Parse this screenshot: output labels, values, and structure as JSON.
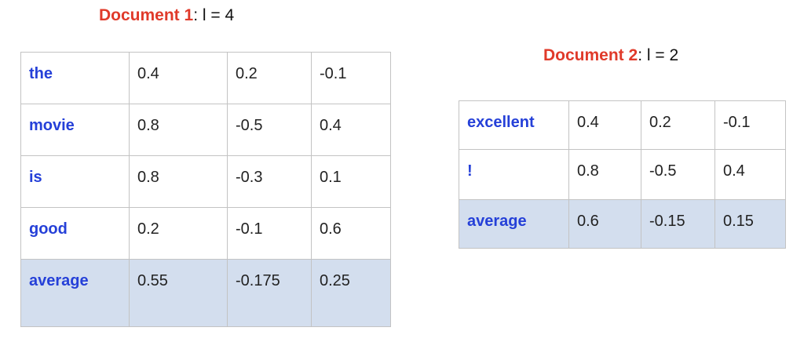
{
  "colors": {
    "title_accent": "#e03a2a",
    "word_text": "#2540d8",
    "average_row_bg": "#d3deee",
    "grid_line": "#c3c3c3"
  },
  "doc1": {
    "name": "Document 1",
    "length_label": ": l = 4",
    "rows": [
      {
        "word": "the",
        "values": [
          "0.4",
          "0.2",
          "-0.1"
        ]
      },
      {
        "word": "movie",
        "values": [
          "0.8",
          "-0.5",
          "0.4"
        ]
      },
      {
        "word": "is",
        "values": [
          "0.8",
          "-0.3",
          "0.1"
        ]
      },
      {
        "word": "good",
        "values": [
          "0.2",
          "-0.1",
          "0.6"
        ]
      },
      {
        "word": "average",
        "values": [
          "0.55",
          "-0.175",
          "0.25"
        ]
      }
    ]
  },
  "doc2": {
    "name": "Document 2",
    "length_label": ": l = 2",
    "rows": [
      {
        "word": "excellent",
        "values": [
          "0.4",
          "0.2",
          "-0.1"
        ]
      },
      {
        "word": "!",
        "values": [
          "0.8",
          "-0.5",
          "0.4"
        ]
      },
      {
        "word": "average",
        "values": [
          "0.6",
          "-0.15",
          "0.15"
        ]
      }
    ]
  }
}
